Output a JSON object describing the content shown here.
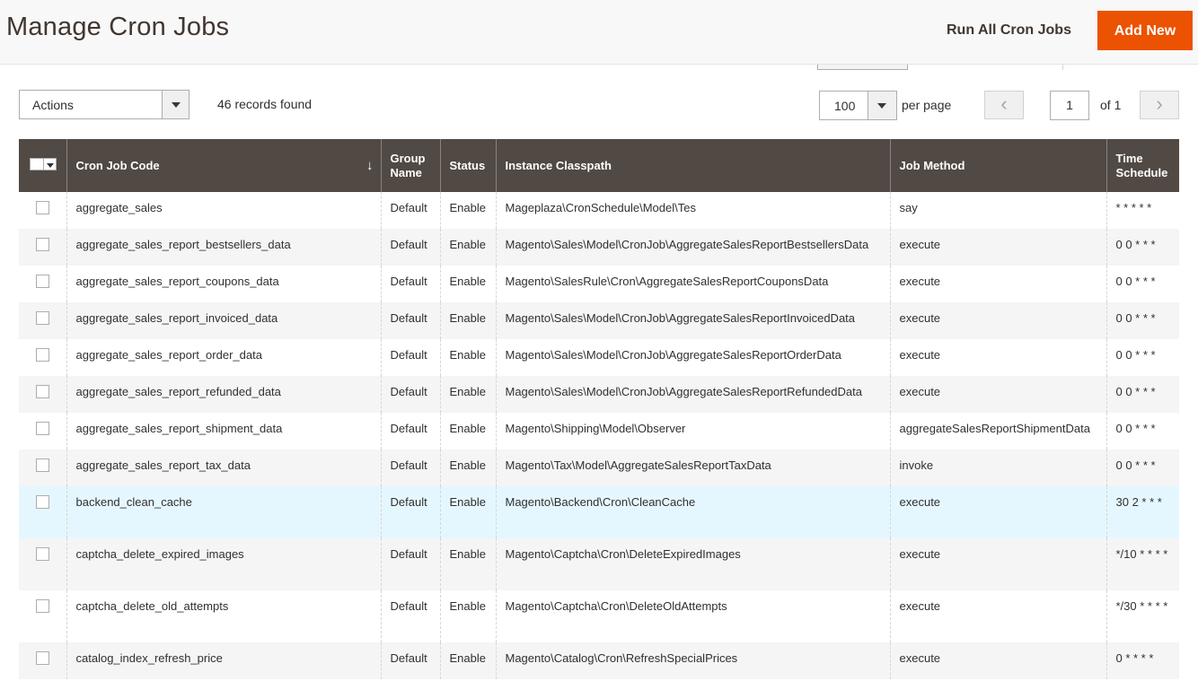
{
  "header": {
    "title": "Manage Cron Jobs",
    "run_all_label": "Run All Cron Jobs",
    "add_new_label": "Add New"
  },
  "toolbar": {
    "actions_label": "Actions",
    "records_found": "46 records found",
    "per_page_value": "100",
    "per_page_label": "per page",
    "current_page": "1",
    "of_pages": "of 1",
    "prev_icon": "‹",
    "next_icon": "›"
  },
  "colors": {
    "accent": "#eb5202",
    "grid_header": "#514943",
    "row_hover": "#e5f7fe"
  },
  "grid": {
    "columns": {
      "code": "Cron Job Code",
      "group_line1": "Group",
      "group_line2": "Name",
      "status": "Status",
      "classpath": "Instance Classpath",
      "method": "Job Method",
      "schedule_line1": "Time",
      "schedule_line2": "Schedule",
      "sort_icon": "↓"
    },
    "rows": [
      {
        "code": "aggregate_sales",
        "group": "Default",
        "status": "Enable",
        "classpath": "Mageplaza\\CronSchedule\\Model\\Tes",
        "method": "say",
        "schedule": "* * * * *"
      },
      {
        "code": "aggregate_sales_report_bestsellers_data",
        "group": "Default",
        "status": "Enable",
        "classpath": "Magento\\Sales\\Model\\CronJob\\AggregateSalesReportBestsellersData",
        "method": "execute",
        "schedule": "0 0 * * *"
      },
      {
        "code": "aggregate_sales_report_coupons_data",
        "group": "Default",
        "status": "Enable",
        "classpath": "Magento\\SalesRule\\Cron\\AggregateSalesReportCouponsData",
        "method": "execute",
        "schedule": "0 0 * * *"
      },
      {
        "code": "aggregate_sales_report_invoiced_data",
        "group": "Default",
        "status": "Enable",
        "classpath": "Magento\\Sales\\Model\\CronJob\\AggregateSalesReportInvoicedData",
        "method": "execute",
        "schedule": "0 0 * * *"
      },
      {
        "code": "aggregate_sales_report_order_data",
        "group": "Default",
        "status": "Enable",
        "classpath": "Magento\\Sales\\Model\\CronJob\\AggregateSalesReportOrderData",
        "method": "execute",
        "schedule": "0 0 * * *"
      },
      {
        "code": "aggregate_sales_report_refunded_data",
        "group": "Default",
        "status": "Enable",
        "classpath": "Magento\\Sales\\Model\\CronJob\\AggregateSalesReportRefundedData",
        "method": "execute",
        "schedule": "0 0 * * *"
      },
      {
        "code": "aggregate_sales_report_shipment_data",
        "group": "Default",
        "status": "Enable",
        "classpath": "Magento\\Shipping\\Model\\Observer",
        "method": "aggregateSalesReportShipmentData",
        "schedule": "0 0 * * *"
      },
      {
        "code": "aggregate_sales_report_tax_data",
        "group": "Default",
        "status": "Enable",
        "classpath": "Magento\\Tax\\Model\\AggregateSalesReportTaxData",
        "method": "invoke",
        "schedule": "0 0 * * *"
      },
      {
        "code": "backend_clean_cache",
        "group": "Default",
        "status": "Enable",
        "classpath": "Magento\\Backend\\Cron\\CleanCache",
        "method": "execute",
        "schedule": "30 2 * * *"
      },
      {
        "code": "captcha_delete_expired_images",
        "group": "Default",
        "status": "Enable",
        "classpath": "Magento\\Captcha\\Cron\\DeleteExpiredImages",
        "method": "execute",
        "schedule": "*/10 * * * *"
      },
      {
        "code": "captcha_delete_old_attempts",
        "group": "Default",
        "status": "Enable",
        "classpath": "Magento\\Captcha\\Cron\\DeleteOldAttempts",
        "method": "execute",
        "schedule": "*/30 * * * *"
      },
      {
        "code": "catalog_index_refresh_price",
        "group": "Default",
        "status": "Enable",
        "classpath": "Magento\\Catalog\\Cron\\RefreshSpecialPrices",
        "method": "execute",
        "schedule": "0 * * * *"
      }
    ]
  }
}
